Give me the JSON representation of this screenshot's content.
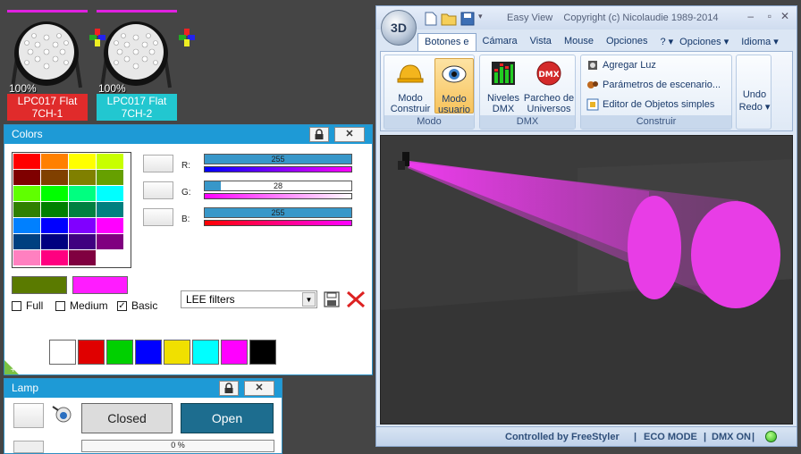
{
  "fixtures": [
    {
      "percent": "100%",
      "name": "LPC017 Flat",
      "mode": "7CH-1",
      "label_color": "#e02b2b"
    },
    {
      "percent": "100%",
      "name": "LPC017 Flat",
      "mode": "7CH-2",
      "label_color": "#22c7d0"
    }
  ],
  "colors_panel": {
    "title": "Colors",
    "lock_icon": "lock-icon",
    "close_label": "✕",
    "swatches": [
      "#ff0000",
      "#ff8000",
      "#ffff00",
      "#c8ff00",
      "#7f0000",
      "#804000",
      "#808000",
      "#66a000",
      "#60ff00",
      "#00ff00",
      "#00ff80",
      "#00ffff",
      "#2f8000",
      "#008000",
      "#008040",
      "#008080",
      "#0080ff",
      "#0000ff",
      "#8000ff",
      "#ff00ff",
      "#004080",
      "#000080",
      "#400080",
      "#800080",
      "#ff80c0",
      "#ff0080",
      "#800040",
      "#ffffff"
    ],
    "channels": [
      {
        "label": "R:",
        "value": "255",
        "fraction": 1.0,
        "gradient": "linear-gradient(90deg,#0000ff,#ff00ff)"
      },
      {
        "label": "G:",
        "value": "28",
        "fraction": 0.11,
        "gradient": "linear-gradient(90deg,#ff00ff,#ffffff)"
      },
      {
        "label": "B:",
        "value": "255",
        "fraction": 1.0,
        "gradient": "linear-gradient(90deg,#ff0000,#ff00ff)"
      }
    ],
    "current_color": "#5a7a00",
    "selected_color": "#ff1cff",
    "options": [
      {
        "label": "Full",
        "checked": false
      },
      {
        "label": "Medium",
        "checked": false
      },
      {
        "label": "Basic",
        "checked": true
      }
    ],
    "filter_select": "LEE filters",
    "basic_colors": [
      "#ffffff",
      "#e00000",
      "#00d000",
      "#0000ff",
      "#f0e000",
      "#00ffff",
      "#ff00ff",
      "#000000"
    ]
  },
  "lamp_panel": {
    "title": "Lamp",
    "close_label": "✕",
    "closed_label": "Closed",
    "open_label": "Open",
    "progress": "0 %"
  },
  "viewer": {
    "orb_label": "3D",
    "title": "Easy View",
    "copyright": "Copyright (c) Nicolaudie 1989-2014",
    "tabs": [
      "Botones e",
      "Cámara",
      "Vista",
      "Mouse",
      "Opciones",
      "?",
      "Opciones",
      "Idioma"
    ],
    "groups": {
      "modo": {
        "label": "Modo",
        "buttons": [
          "Modo\nConstruir",
          "Modo\nusuario"
        ]
      },
      "dmx": {
        "label": "DMX",
        "buttons": [
          "Niveles\nDMX",
          "Parcheo de\nUniversos"
        ]
      },
      "construir": {
        "label": "Construir",
        "items": [
          "Agregar Luz",
          "Parámetros de escenario...",
          "Editor de Objetos simples"
        ]
      },
      "undo": [
        "Undo",
        "Redo"
      ]
    },
    "status": [
      "Controlled by FreeStyler",
      "ECO MODE",
      "DMX ON"
    ]
  }
}
